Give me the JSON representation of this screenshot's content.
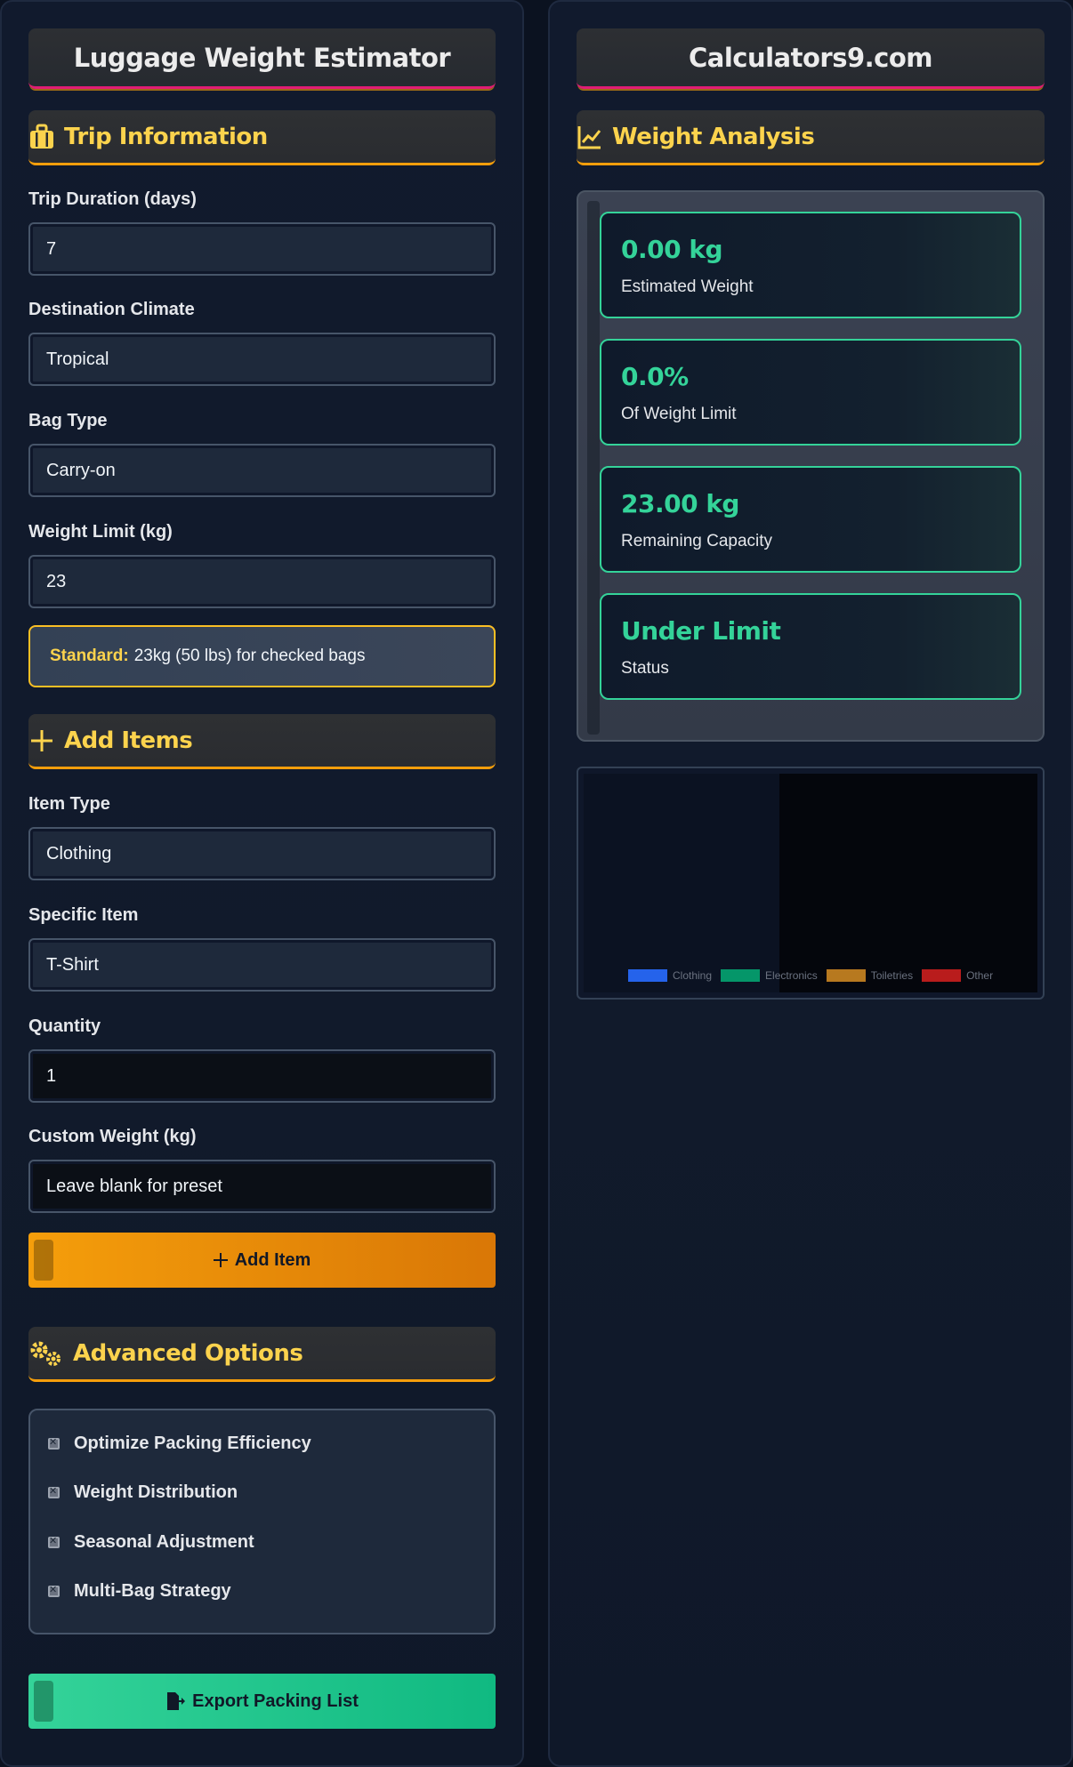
{
  "left": {
    "title": "Luggage Weight Estimator",
    "trip": {
      "heading": "Trip Information",
      "duration_label": "Trip Duration (days)",
      "duration_value": "7",
      "climate_label": "Destination Climate",
      "climate_value": "Tropical",
      "bag_label": "Bag Type",
      "bag_value": "Carry-on",
      "limit_label": "Weight Limit (kg)",
      "limit_value": "23",
      "info_bold": "Standard:",
      "info_text": "23kg (50 lbs) for checked bags"
    },
    "items": {
      "heading": "Add Items",
      "type_label": "Item Type",
      "type_value": "Clothing",
      "specific_label": "Specific Item",
      "specific_value": "T-Shirt",
      "qty_label": "Quantity",
      "qty_value": "1",
      "custom_label": "Custom Weight (kg)",
      "custom_placeholder": "Leave blank for preset",
      "add_button": "Add Item"
    },
    "advanced": {
      "heading": "Advanced Options",
      "options": [
        "Optimize Packing Efficiency",
        "Weight Distribution",
        "Seasonal Adjustment",
        "Multi-Bag Strategy"
      ]
    },
    "export_button": "Export Packing List"
  },
  "right": {
    "title": "Calculators9.com",
    "heading": "Weight Analysis",
    "stats": [
      {
        "value": "0.00 kg",
        "label": "Estimated Weight"
      },
      {
        "value": "0.0%",
        "label": "Of Weight Limit"
      },
      {
        "value": "23.00 kg",
        "label": "Remaining Capacity"
      },
      {
        "value": "Under Limit",
        "label": "Status"
      }
    ],
    "legend": [
      {
        "name": "Clothing",
        "color": "#2563eb"
      },
      {
        "name": "Electronics",
        "color": "#059669"
      },
      {
        "name": "Toiletries",
        "color": "#b7791f"
      },
      {
        "name": "Other",
        "color": "#b91c1c"
      }
    ]
  },
  "colors": {
    "accent_gold": "#fcd34d",
    "accent_green": "#34d399",
    "accent_orange": "#f59e0b",
    "accent_pink": "#e11d74"
  }
}
